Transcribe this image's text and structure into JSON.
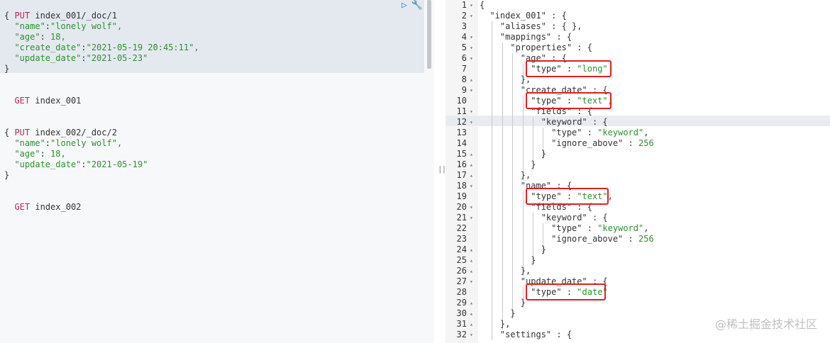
{
  "request_panel": {
    "line1_method": "PUT",
    "line1_path": " index_001/_doc/1",
    "doc1_open": "{",
    "doc1_name_key": "  \"name\"",
    "doc1_name_val": "\"lonely wolf\",",
    "doc1_age_key": "  \"age\"",
    "doc1_age_val": " 18,",
    "doc1_create_key": "  \"create_date\"",
    "doc1_create_val": "\"2021-05-19 20:45:11\",",
    "doc1_update_key": "  \"update_date\"",
    "doc1_update_val": "\"2021-05-23\"",
    "doc1_close": "}",
    "get1_method": "GET",
    "get1_path": " index_001",
    "put2_method": "PUT",
    "put2_path": " index_002/_doc/2",
    "doc2_open": "{",
    "doc2_name_key": "  \"name\"",
    "doc2_name_val": "\"lonely wolf\",",
    "doc2_age_key": "  \"age\"",
    "doc2_age_val": " 18,",
    "doc2_update_key": "  \"update_date\"",
    "doc2_update_val": "\"2021-05-19\"",
    "doc2_close": "}",
    "get2_method": "GET",
    "get2_path": " index_002",
    "run_icon": "play-icon",
    "settings_icon": "wrench-icon"
  },
  "response_panel": {
    "line_numbers": [
      "1",
      "2",
      "3",
      "4",
      "5",
      "6",
      "7",
      "8",
      "9",
      "10",
      "11",
      "12",
      "13",
      "14",
      "15",
      "16",
      "17",
      "18",
      "19",
      "20",
      "21",
      "22",
      "23",
      "24",
      "25",
      "26",
      "27",
      "28",
      "29",
      "30",
      "31",
      "32"
    ],
    "lines": [
      "{",
      "  \"index_001\" : {",
      "    \"aliases\" : { },",
      "    \"mappings\" : {",
      "      \"properties\" : {",
      "        \"age\" : {",
      "          \"type\" : \"long\"",
      "        },",
      "        \"create_date\" : {",
      "          \"type\" : \"text\",",
      "          \"fields\" : {",
      "            \"keyword\" : {",
      "              \"type\" : \"keyword\",",
      "              \"ignore_above\" : 256",
      "            }",
      "          }",
      "        },",
      "        \"name\" : {",
      "          \"type\" : \"text\",",
      "          \"fields\" : {",
      "            \"keyword\" : {",
      "              \"type\" : \"keyword\",",
      "              \"ignore_above\" : 256",
      "            }",
      "          }",
      "        },",
      "        \"update_date\" : {",
      "          \"type\" : \"date\"",
      "        }",
      "      }",
      "    },",
      "    \"settings\" : {"
    ],
    "fold_markers": [
      "▾",
      "▾",
      "",
      "▾",
      "▾",
      "▾",
      "",
      "▴",
      "▾",
      "",
      "▾",
      "▾",
      "",
      "",
      "▴",
      "▴",
      "▴",
      "▾",
      "",
      "▾",
      "▾",
      "",
      "",
      "▴",
      "▴",
      "▴",
      "▾",
      "",
      "▴",
      "▴",
      "▴",
      "▾"
    ]
  },
  "watermark": "@稀土掘金技术社区",
  "colors": {
    "highlight_box": "#e02020",
    "method": "#c7254e",
    "string": "#2f8f2f"
  }
}
